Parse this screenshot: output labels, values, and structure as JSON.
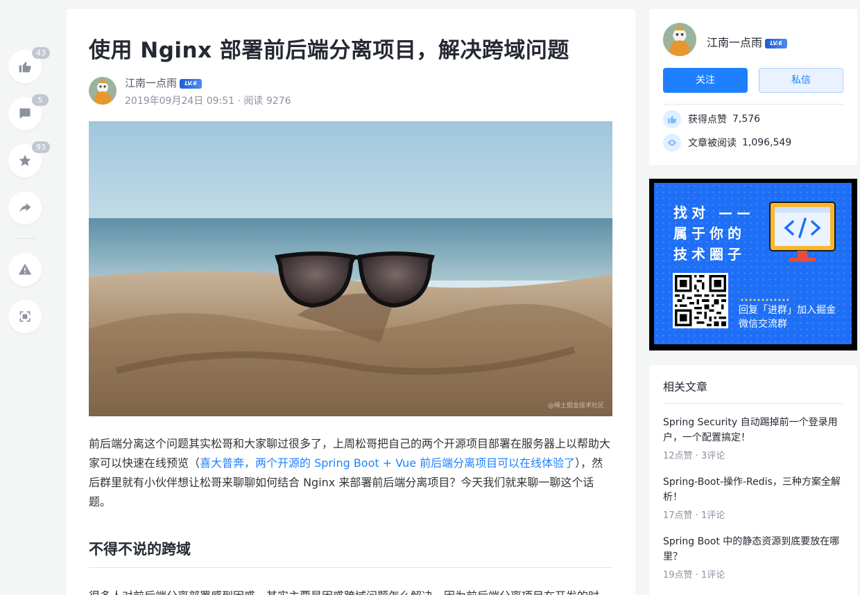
{
  "actions": {
    "like": {
      "count": "43"
    },
    "comment": {
      "count": "5"
    },
    "collect": {
      "count": "93"
    }
  },
  "article": {
    "title": "使用 Nginx 部署前后端分离项目，解决跨域问题",
    "author": "江南一点雨",
    "level": "LV.6",
    "meta": "2019年09月24日 09:51 · 阅读 9276",
    "image_watermark": "@稀土掘金技术社区",
    "para1_before": "前后端分离这个问题其实松哥和大家聊过很多了，上周松哥把自己的两个开源项目部署在服务器上以帮助大家可以快速在线预览（",
    "para1_link": "喜大普奔，两个开源的 Spring Boot + Vue 前后端分离项目可以在线体验了",
    "para1_after": "），然后群里就有小伙伴想让松哥来聊聊如何结合 Nginx 来部署前后端分离项目？今天我们就来聊一聊这个话题。",
    "h2": "不得不说的跨域",
    "para2": "很多人对前后端分离部署感到困惑，其实主要是困惑跨域问题怎么解决，因为前后端分离项目在开发的时"
  },
  "profile": {
    "name": "江南一点雨",
    "level": "LV.6",
    "follow_label": "关注",
    "message_label": "私信",
    "likes_label": "获得点赞",
    "likes_value": "7,576",
    "reads_label": "文章被阅读",
    "reads_value": "1,096,549"
  },
  "ad": {
    "line1": "找对 ——",
    "line2": "属于你的",
    "line3": "技术圈子",
    "text1": "回复「进群」加入掘金",
    "text2": "微信交流群"
  },
  "related": {
    "heading": "相关文章",
    "items": [
      {
        "title": "Spring Security 自动踢掉前一个登录用户，一个配置搞定！",
        "meta": "12点赞 · 3评论"
      },
      {
        "title": "Spring-Boot-操作-Redis，三种方案全解析！",
        "meta": "17点赞 · 1评论"
      },
      {
        "title": "Spring Boot 中的静态资源到底要放在哪里？",
        "meta": "19点赞 · 1评论"
      }
    ]
  }
}
